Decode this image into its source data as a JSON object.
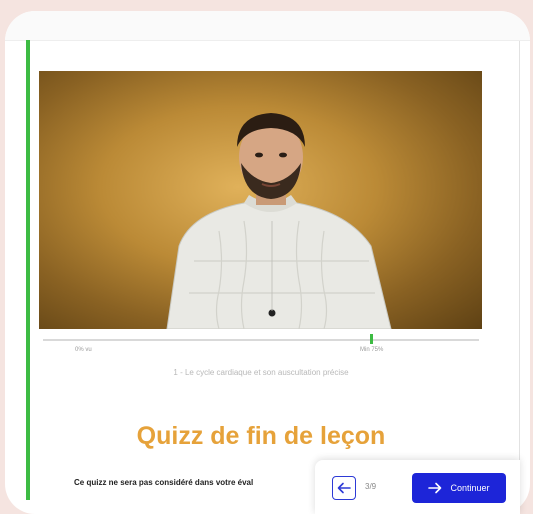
{
  "progress": {
    "start_label": "0% vu",
    "min_label": "Min 75%",
    "fraction": 0.75
  },
  "lesson": {
    "subtitle": "1 - Le cycle cardiaque et son auscultation précise"
  },
  "quiz": {
    "title": "Quizz de fin de leçon",
    "description": "Ce quizz ne sera pas considéré dans votre éval"
  },
  "navigation": {
    "counter": "3/9",
    "continue_label": "Continuer",
    "back_icon": "arrow-left-icon",
    "continue_icon": "arrow-right-icon"
  },
  "colors": {
    "accent_green": "#3dbb43",
    "quiz_title": "#e6a23a",
    "primary_button": "#1d25d8",
    "background": "#f5e4e0"
  }
}
